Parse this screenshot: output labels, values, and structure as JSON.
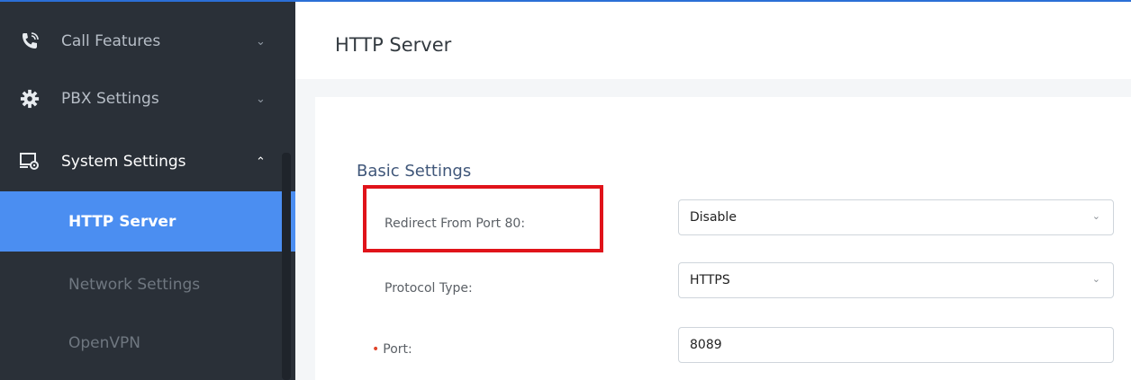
{
  "sidebar": {
    "items": [
      {
        "label": "Call Features",
        "icon": "phone-call-icon"
      },
      {
        "label": "PBX Settings",
        "icon": "gear-icon"
      },
      {
        "label": "System Settings",
        "icon": "system-settings-icon"
      }
    ],
    "subitems": [
      {
        "label": "HTTP Server",
        "active": true
      },
      {
        "label": "Network Settings",
        "active": false
      },
      {
        "label": "OpenVPN",
        "active": false
      }
    ]
  },
  "page": {
    "title": "HTTP Server"
  },
  "form": {
    "section_title": "Basic Settings",
    "redirect_label": "Redirect From Port 80:",
    "redirect_value": "Disable",
    "protocol_label": "Protocol Type:",
    "protocol_value": "HTTPS",
    "port_required": "•",
    "port_label": "Port:",
    "port_value": "8089"
  },
  "colors": {
    "sidebar_bg": "#2a3038",
    "active_bg": "#4b8ef1",
    "highlight": "#e0131a",
    "accent": "#2b6fd6"
  }
}
